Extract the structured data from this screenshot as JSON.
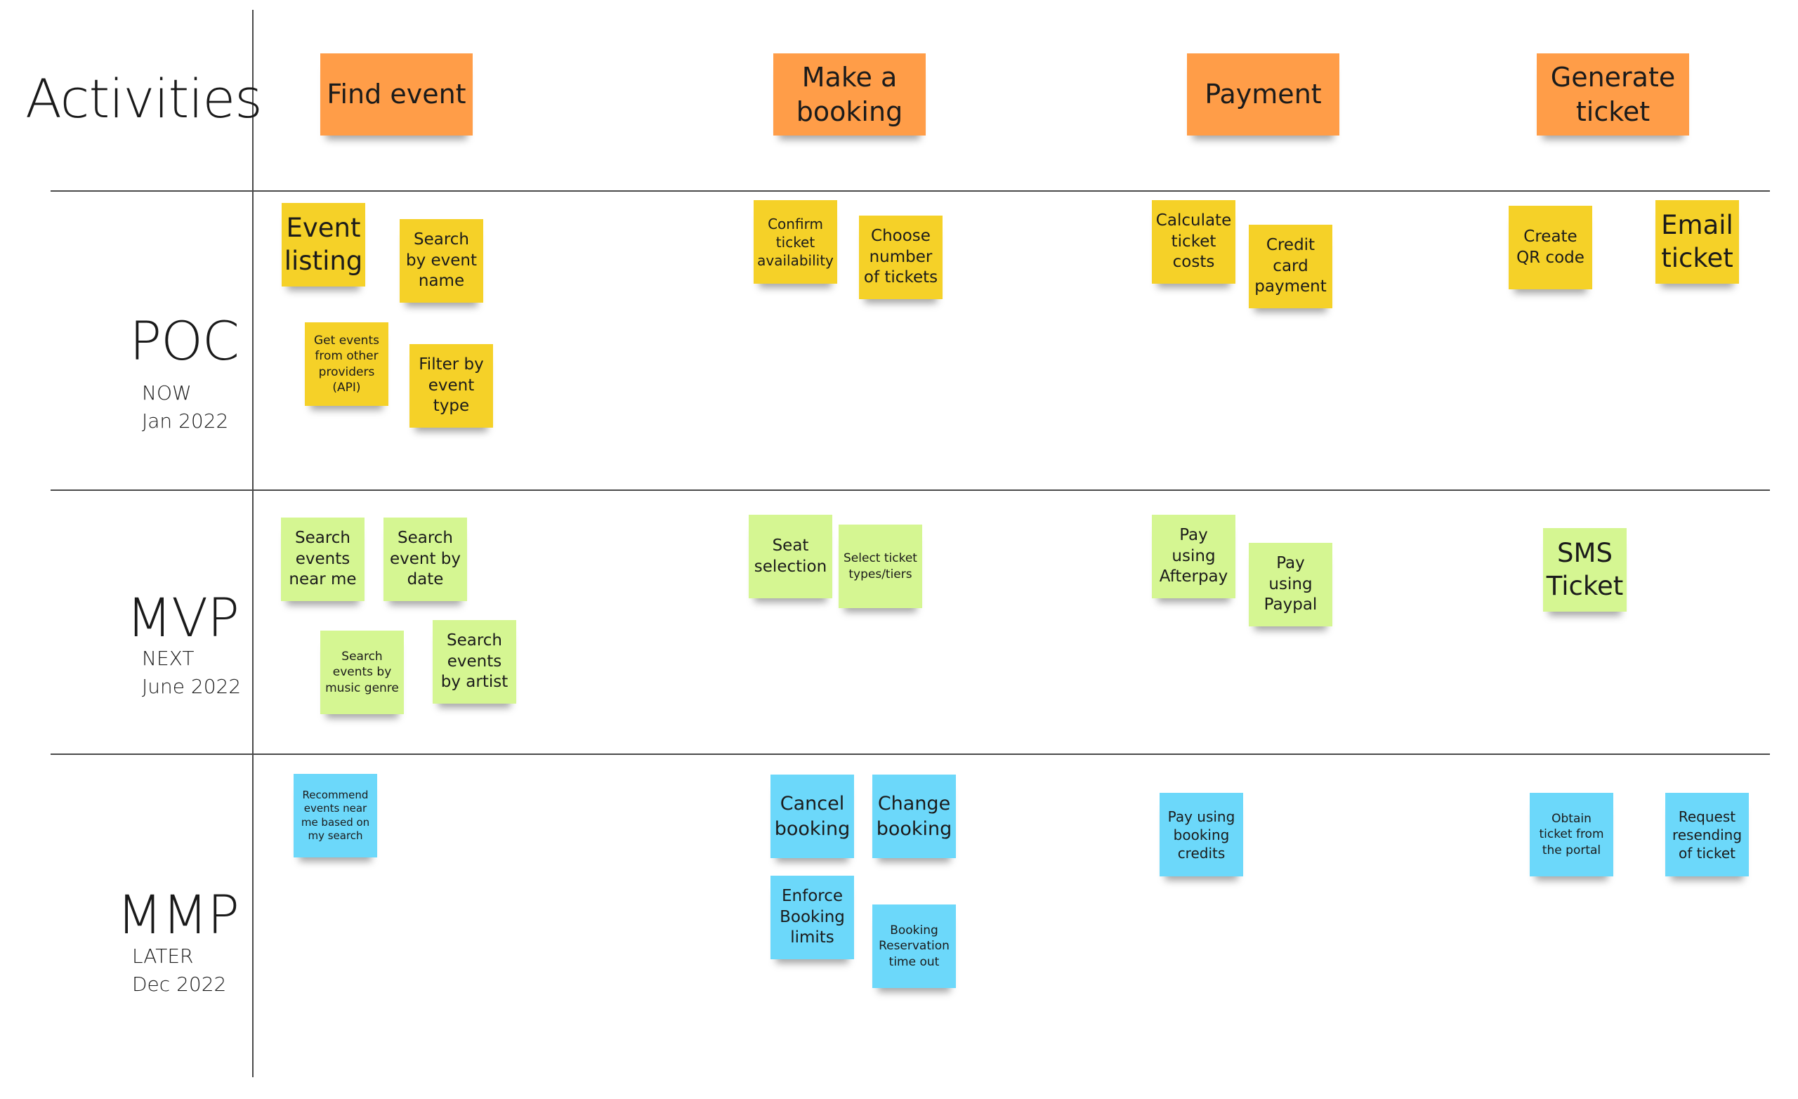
{
  "board": {
    "header_label": "Activities",
    "colors": {
      "activity": "#FF9D48",
      "poc": "#F5D128",
      "mvp": "#D5F692",
      "mmp": "#6CD8FA",
      "grid_line": "#4a4a4a"
    }
  },
  "activities": [
    {
      "label": "Find event"
    },
    {
      "label": "Make a booking"
    },
    {
      "label": "Payment"
    },
    {
      "label": "Generate ticket"
    }
  ],
  "releases": [
    {
      "stage": "POC",
      "when": "NOW",
      "date": "Jan 2022"
    },
    {
      "stage": "MVP",
      "when": "NEXT",
      "date": "June 2022"
    },
    {
      "stage": "MMP",
      "when": "LATER",
      "date": "Dec 2022"
    }
  ],
  "stickies": {
    "poc": {
      "find_event": [
        "Event listing",
        "Search by event name",
        "Get events from other providers (API)",
        "Filter by event type"
      ],
      "make_booking": [
        "Confirm ticket availability",
        "Choose number of tickets"
      ],
      "payment": [
        "Calculate ticket costs",
        "Credit card payment"
      ],
      "generate_ticket": [
        "Create QR code",
        "Email ticket"
      ]
    },
    "mvp": {
      "find_event": [
        "Search events near me",
        "Search event by date",
        "Search events by music genre",
        "Search events by artist"
      ],
      "make_booking": [
        "Seat selection",
        "Select ticket types/tiers"
      ],
      "payment": [
        "Pay using Afterpay",
        "Pay using Paypal"
      ],
      "generate_ticket": [
        "SMS Ticket"
      ]
    },
    "mmp": {
      "find_event": [
        "Recommend events near me based on my search"
      ],
      "make_booking": [
        "Cancel booking",
        "Change booking",
        "Enforce Booking limits",
        "Booking Reservation time out"
      ],
      "payment": [
        "Pay using booking credits"
      ],
      "generate_ticket": [
        "Obtain ticket from the portal",
        "Request resending of ticket"
      ]
    }
  }
}
